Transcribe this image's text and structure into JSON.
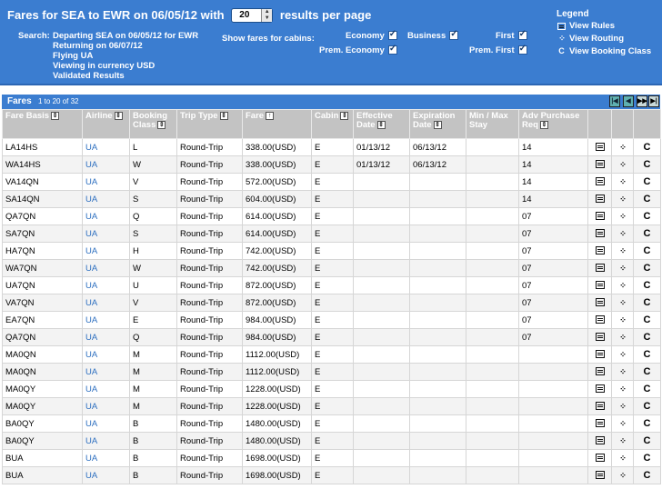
{
  "header": {
    "title_prefix": "Fares for SEA to EWR on 06/05/12 with",
    "per_page_value": "20",
    "title_suffix": "results per page",
    "search_label": "Search:",
    "search_lines": [
      "Departing SEA on 06/05/12 for EWR",
      "Returning on 06/07/12",
      "Flying UA",
      "Viewing in currency USD",
      "Validated Results"
    ],
    "show_fares_label": "Show fares for cabins:",
    "cabins": {
      "economy": "Economy",
      "business": "Business",
      "first": "First",
      "prem_economy": "Prem. Economy",
      "prem_first": "Prem. First"
    }
  },
  "legend": {
    "title": "Legend",
    "items": [
      {
        "label": "View Rules",
        "icon": "rules-icon"
      },
      {
        "label": "View Routing",
        "icon": "routing-icon"
      },
      {
        "label": "View Booking Class",
        "icon": "booking-class-icon"
      }
    ]
  },
  "fares": {
    "label": "Fares",
    "range": "1 to 20 of 32",
    "pager": [
      "|◀",
      "◀",
      "▶▶",
      "▶|"
    ],
    "columns": [
      "Fare Basis",
      "Airline",
      "Booking Class",
      "Trip Type",
      "Fare",
      "Cabin",
      "Effective Date",
      "Expiration Date",
      "Min / Max Stay",
      "Adv Purchase Req"
    ],
    "rows": [
      [
        "LA14HS",
        "UA",
        "L",
        "Round-Trip",
        "338.00(USD)",
        "E",
        "01/13/12",
        "06/13/12",
        "",
        "14"
      ],
      [
        "WA14HS",
        "UA",
        "W",
        "Round-Trip",
        "338.00(USD)",
        "E",
        "01/13/12",
        "06/13/12",
        "",
        "14"
      ],
      [
        "VA14QN",
        "UA",
        "V",
        "Round-Trip",
        "572.00(USD)",
        "E",
        "",
        "",
        "",
        "14"
      ],
      [
        "SA14QN",
        "UA",
        "S",
        "Round-Trip",
        "604.00(USD)",
        "E",
        "",
        "",
        "",
        "14"
      ],
      [
        "QA7QN",
        "UA",
        "Q",
        "Round-Trip",
        "614.00(USD)",
        "E",
        "",
        "",
        "",
        "07"
      ],
      [
        "SA7QN",
        "UA",
        "S",
        "Round-Trip",
        "614.00(USD)",
        "E",
        "",
        "",
        "",
        "07"
      ],
      [
        "HA7QN",
        "UA",
        "H",
        "Round-Trip",
        "742.00(USD)",
        "E",
        "",
        "",
        "",
        "07"
      ],
      [
        "WA7QN",
        "UA",
        "W",
        "Round-Trip",
        "742.00(USD)",
        "E",
        "",
        "",
        "",
        "07"
      ],
      [
        "UA7QN",
        "UA",
        "U",
        "Round-Trip",
        "872.00(USD)",
        "E",
        "",
        "",
        "",
        "07"
      ],
      [
        "VA7QN",
        "UA",
        "V",
        "Round-Trip",
        "872.00(USD)",
        "E",
        "",
        "",
        "",
        "07"
      ],
      [
        "EA7QN",
        "UA",
        "E",
        "Round-Trip",
        "984.00(USD)",
        "E",
        "",
        "",
        "",
        "07"
      ],
      [
        "QA7QN",
        "UA",
        "Q",
        "Round-Trip",
        "984.00(USD)",
        "E",
        "",
        "",
        "",
        "07"
      ],
      [
        "MA0QN",
        "UA",
        "M",
        "Round-Trip",
        "1112.00(USD)",
        "E",
        "",
        "",
        "",
        ""
      ],
      [
        "MA0QN",
        "UA",
        "M",
        "Round-Trip",
        "1112.00(USD)",
        "E",
        "",
        "",
        "",
        ""
      ],
      [
        "MA0QY",
        "UA",
        "M",
        "Round-Trip",
        "1228.00(USD)",
        "E",
        "",
        "",
        "",
        ""
      ],
      [
        "MA0QY",
        "UA",
        "M",
        "Round-Trip",
        "1228.00(USD)",
        "E",
        "",
        "",
        "",
        ""
      ],
      [
        "BA0QY",
        "UA",
        "B",
        "Round-Trip",
        "1480.00(USD)",
        "E",
        "",
        "",
        "",
        ""
      ],
      [
        "BA0QY",
        "UA",
        "B",
        "Round-Trip",
        "1480.00(USD)",
        "E",
        "",
        "",
        "",
        ""
      ],
      [
        "BUA",
        "UA",
        "B",
        "Round-Trip",
        "1698.00(USD)",
        "E",
        "",
        "",
        "",
        ""
      ],
      [
        "BUA",
        "UA",
        "B",
        "Round-Trip",
        "1698.00(USD)",
        "E",
        "",
        "",
        "",
        ""
      ]
    ]
  }
}
